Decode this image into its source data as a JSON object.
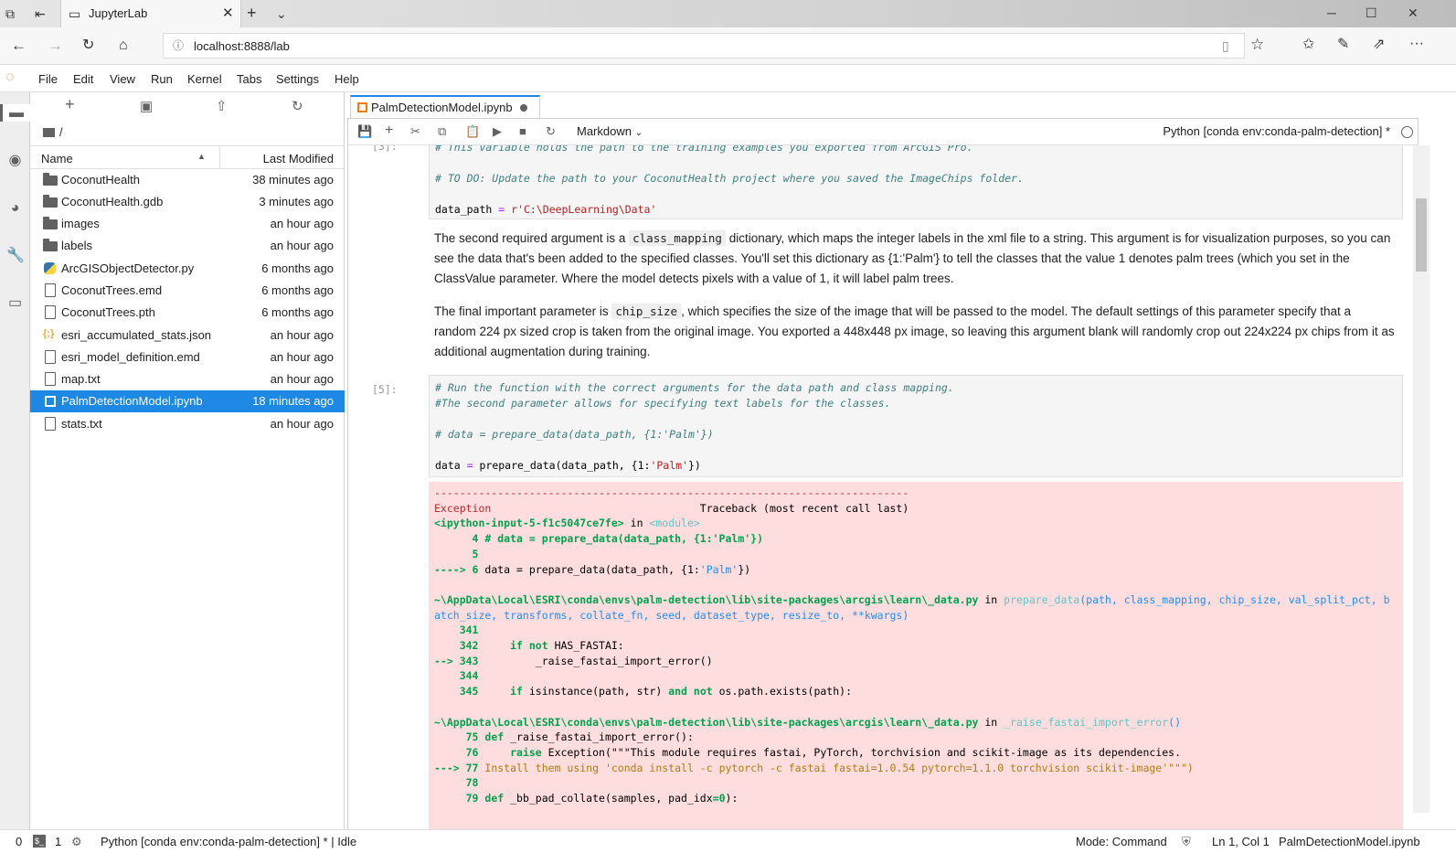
{
  "browser": {
    "tab_title": "JupyterLab",
    "url": "localhost:8888/lab"
  },
  "menu": [
    "File",
    "Edit",
    "View",
    "Run",
    "Kernel",
    "Tabs",
    "Settings",
    "Help"
  ],
  "file_browser": {
    "breadcrumb": "/",
    "col_name": "Name",
    "col_modified": "Last Modified",
    "files": [
      {
        "name": "CoconutHealth",
        "modified": "38 minutes ago",
        "type": "folder"
      },
      {
        "name": "CoconutHealth.gdb",
        "modified": "3 minutes ago",
        "type": "folder"
      },
      {
        "name": "images",
        "modified": "an hour ago",
        "type": "folder"
      },
      {
        "name": "labels",
        "modified": "an hour ago",
        "type": "folder"
      },
      {
        "name": "ArcGISObjectDetector.py",
        "modified": "6 months ago",
        "type": "python"
      },
      {
        "name": "CoconutTrees.emd",
        "modified": "6 months ago",
        "type": "file"
      },
      {
        "name": "CoconutTrees.pth",
        "modified": "6 months ago",
        "type": "file"
      },
      {
        "name": "esri_accumulated_stats.json",
        "modified": "an hour ago",
        "type": "json"
      },
      {
        "name": "esri_model_definition.emd",
        "modified": "an hour ago",
        "type": "file"
      },
      {
        "name": "map.txt",
        "modified": "an hour ago",
        "type": "file"
      },
      {
        "name": "PalmDetectionModel.ipynb",
        "modified": "18 minutes ago",
        "type": "notebook",
        "selected": true
      },
      {
        "name": "stats.txt",
        "modified": "an hour ago",
        "type": "file"
      }
    ]
  },
  "notebook": {
    "tab_title": "PalmDetectionModel.ipynb",
    "cell_type": "Markdown",
    "kernel": "Python [conda env:conda-palm-detection] *",
    "cell1_prompt": "[3]:",
    "cell1_line0": "# This variable holds the path to the training examples you exported from ArcGIS Pro.",
    "cell1_line1": "# TO DO: Update the path to your CoconutHealth project where you saved the ImageChips folder.",
    "cell1_line2a": "data_path ",
    "cell1_line2b": "=",
    "cell1_line2c": " r'C:\\DeepLearning\\Data'",
    "md1_a": "The second required argument is a ",
    "md1_code": "class_mapping",
    "md1_b": " dictionary, which maps the integer labels in the xml file to a string. This argument is for visualization purposes, so you can see the data that's been added to the specified classes. You'll set this dictionary as {1:'Palm'} to tell the classes that the value 1 denotes palm trees (which you set in the ClassValue parameter. Where the model detects pixels with a value of 1, it will label palm trees.",
    "md2_a": "The final important parameter is ",
    "md2_code": "chip_size",
    "md2_b": ", which specifies the size of the image that will be passed to the model. The default settings of this parameter specify that a random 224 px sized crop is taken from the original image. You exported a 448x448 px image, so leaving this argument blank will randomly crop out 224x224 px chips from it as additional augmentation during training.",
    "cell2_prompt": "[5]:",
    "cell2_line0": "# Run the function with the correct arguments for the data path and class mapping.",
    "cell2_line1": "#The second parameter allows for specifying text labels for the classes.",
    "cell2_line2": "# data = prepare_data(data_path, {1:'Palm'})",
    "cell2_line3a": "data ",
    "cell2_line3b": "=",
    "cell2_line3c": " prepare_data(data_path, {1:",
    "cell2_line3d": "'Palm'",
    "cell2_line3e": "})",
    "traceback": {
      "rule": "---------------------------------------------------------------------------",
      "exc": "Exception",
      "tb_title": "                                 Traceback (most recent call last)",
      "input_ref": "<ipython-input-5-f1c5047ce7fe>",
      "in": " in ",
      "module": "<module>",
      "l4": "      4 # data = prepare_data(data_path, {1:'Palm'})",
      "l5": "      5",
      "l6a": "----> 6 ",
      "l6b": "data = prepare_data(data_path, {1:",
      "l6c": "'Palm'",
      "l6d": "})",
      "file1": "~\\AppData\\Local\\ESRI\\conda\\envs\\palm-detection\\lib\\site-packages\\arcgis\\learn\\_data.py",
      "fn1": "prepare_data",
      "args1a": "(path, class_mapping, chip_size, val_split_pct, b",
      "args1b": "atch_size, transforms, collate_fn, seed, dataset_type, resize_to, **kwargs)",
      "l341": "    341",
      "l342a": "    342     ",
      "l342b": "if not",
      "l342c": " HAS_FASTAI:",
      "l343a": "--> 343 ",
      "l343b": "        _raise_fastai_import_error()",
      "l344": "    344",
      "l345a": "    345     ",
      "l345b": "if",
      "l345c": " isinstance(path, str) ",
      "l345d": "and not",
      "l345e": " os.path.exists(path):",
      "file2": "~\\AppData\\Local\\ESRI\\conda\\envs\\palm-detection\\lib\\site-packages\\arcgis\\learn\\_data.py",
      "fn2": "_raise_fastai_import_error",
      "args2": "()",
      "l75a": "     75 ",
      "l75b": "def",
      "l75c": " _raise_fastai_import_error():",
      "l76a": "     76     ",
      "l76b": "raise",
      "l76c": " Exception(\"\"\"This module requires fastai, PyTorch, torchvision and scikit-image as its dependencies.",
      "l77a": "---> 77 ",
      "l77b": "Install them using 'conda install -c pytorch -c fastai fastai=1.0.54 pytorch=1.1.0 torchvision scikit-image'\"\"\")",
      "l78": "     78",
      "l79a": "     79 ",
      "l79b": "def",
      "l79c": " _bb_pad_collate(samples, pad_idx",
      "l79d": "=0",
      "l79e": "):"
    }
  },
  "status": {
    "left0": "0",
    "left1": "1",
    "kernel": "Python [conda env:conda-palm-detection] * | Idle",
    "mode": "Mode: Command",
    "pos": "Ln 1, Col 1",
    "file": "PalmDetectionModel.ipynb"
  }
}
